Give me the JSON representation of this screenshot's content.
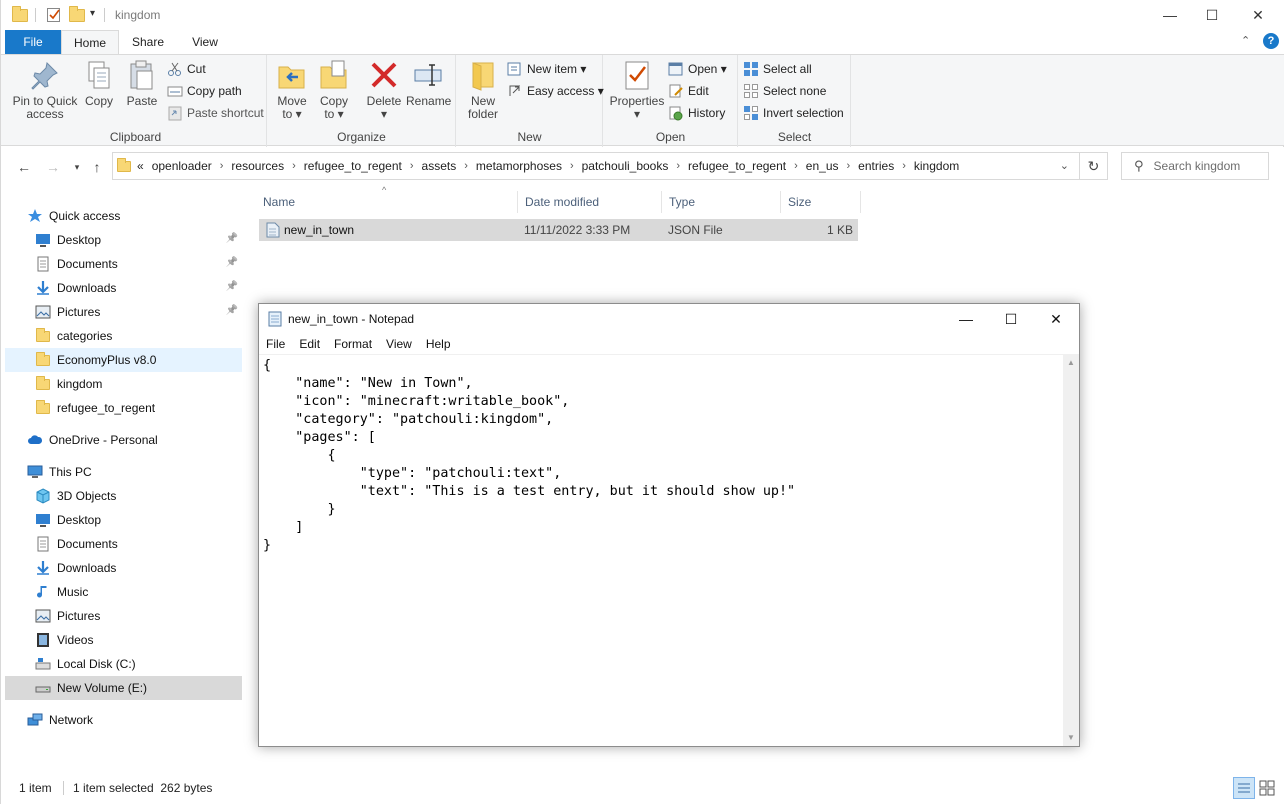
{
  "window": {
    "title": "kingdom",
    "minimize_glyph": "—",
    "maximize_glyph": "☐",
    "close_glyph": "✕"
  },
  "ribbon_tabs": [
    "File",
    "Home",
    "Share",
    "View"
  ],
  "ribbon": {
    "clipboard": {
      "label": "Clipboard",
      "pin_label_1": "Pin to Quick",
      "pin_label_2": "access",
      "copy": "Copy",
      "paste": "Paste",
      "cut": "Cut",
      "copy_path": "Copy path",
      "paste_shortcut": "Paste shortcut"
    },
    "organize": {
      "label": "Organize",
      "move_1": "Move",
      "move_2": "to ▾",
      "copy_1": "Copy",
      "copy_2": "to ▾",
      "delete": "Delete",
      "delete_2": "▾",
      "rename": "Rename"
    },
    "new": {
      "label": "New",
      "new_folder_1": "New",
      "new_folder_2": "folder",
      "new_item": "New item ▾",
      "easy_access": "Easy access ▾"
    },
    "open": {
      "label": "Open",
      "properties": "Properties",
      "properties_2": "▾",
      "open": "Open ▾",
      "edit": "Edit",
      "history": "History"
    },
    "select": {
      "label": "Select",
      "select_all": "Select all",
      "select_none": "Select none",
      "invert": "Invert selection"
    }
  },
  "address": {
    "chevrons": "«",
    "crumbs": [
      "openloader",
      "resources",
      "refugee_to_regent",
      "assets",
      "metamorphoses",
      "patchouli_books",
      "refugee_to_regent",
      "en_us",
      "entries",
      "kingdom"
    ],
    "separator": "›",
    "search_placeholder": "Search kingdom"
  },
  "navpane": {
    "quick_access": "Quick access",
    "qa_items": [
      "Desktop",
      "Documents",
      "Downloads",
      "Pictures",
      "categories",
      "EconomyPlus v8.0",
      "kingdom",
      "refugee_to_regent"
    ],
    "onedrive": "OneDrive - Personal",
    "this_pc": "This PC",
    "pc_items": [
      "3D Objects",
      "Desktop",
      "Documents",
      "Downloads",
      "Music",
      "Pictures",
      "Videos",
      "Local Disk (C:)",
      "New Volume (E:)"
    ],
    "network": "Network"
  },
  "filelist": {
    "headers": [
      "Name",
      "Date modified",
      "Type",
      "Size"
    ],
    "rows": [
      {
        "name": "new_in_town",
        "date": "11/11/2022 3:33 PM",
        "type": "JSON File",
        "size": "1 KB"
      }
    ]
  },
  "status": {
    "count": "1 item",
    "selected": "1 item selected  262 bytes"
  },
  "notepad": {
    "title": "new_in_town - Notepad",
    "menu": [
      "File",
      "Edit",
      "Format",
      "View",
      "Help"
    ],
    "content": "{\n    \"name\": \"New in Town\",\n    \"icon\": \"minecraft:writable_book\",\n    \"category\": \"patchouli:kingdom\",\n    \"pages\": [\n        {\n            \"type\": \"patchouli:text\",\n            \"text\": \"This is a test entry, but it should show up!\"\n        }\n    ]\n}"
  },
  "colors": {
    "file_tab": "#1979ca",
    "selection": "#d9d9d9",
    "folder": "#f8d775"
  }
}
